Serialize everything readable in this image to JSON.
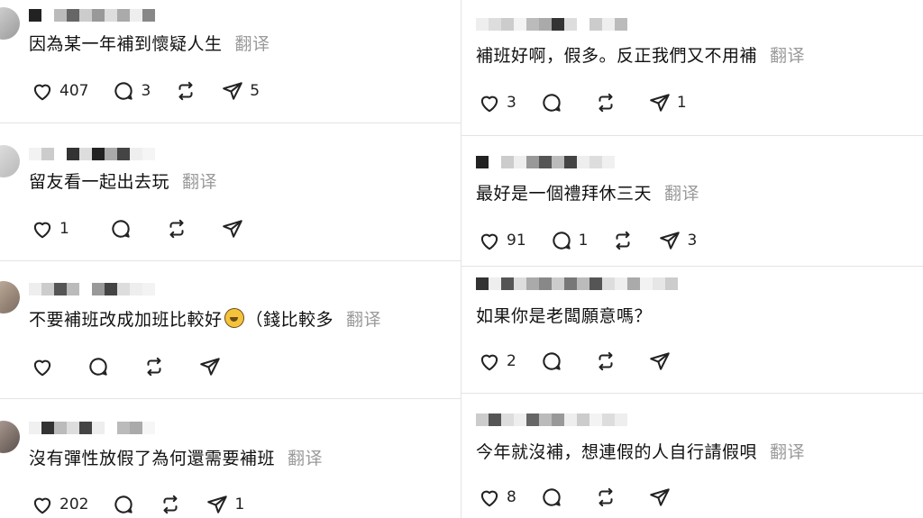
{
  "translate_label": "翻译",
  "left": [
    {
      "text": "因為某一年補到懷疑人生",
      "likes": "407",
      "replies": "3",
      "reposts": "",
      "shares": "5",
      "has_emoji": false
    },
    {
      "text": "留友看一起出去玩",
      "likes": "1",
      "replies": "",
      "reposts": "",
      "shares": "",
      "has_emoji": false
    },
    {
      "text_before": "不要補班改成加班比較好",
      "text_after": "（錢比較多",
      "likes": "",
      "replies": "",
      "reposts": "",
      "shares": "",
      "has_emoji": true,
      "emoji": "rolling-laughing-emoji"
    },
    {
      "text": "沒有彈性放假了為何還需要補班",
      "likes": "202",
      "replies": "",
      "reposts": "",
      "shares": "1",
      "has_emoji": false
    }
  ],
  "right": [
    {
      "text": "補班好啊，假多。反正我們又不用補",
      "likes": "3",
      "replies": "",
      "reposts": "",
      "shares": "1"
    },
    {
      "text": "最好是一個禮拜休三天",
      "likes": "91",
      "replies": "1",
      "reposts": "",
      "shares": "3"
    },
    {
      "text": "如果你是老闆願意嗎？",
      "likes": "2",
      "replies": "",
      "reposts": "",
      "shares": ""
    },
    {
      "text": "今年就沒補，想連假的人自行請假唄",
      "likes": "8",
      "replies": "",
      "reposts": "",
      "shares": ""
    }
  ],
  "icons": [
    "heart-icon",
    "comment-icon",
    "repost-icon",
    "send-icon"
  ]
}
